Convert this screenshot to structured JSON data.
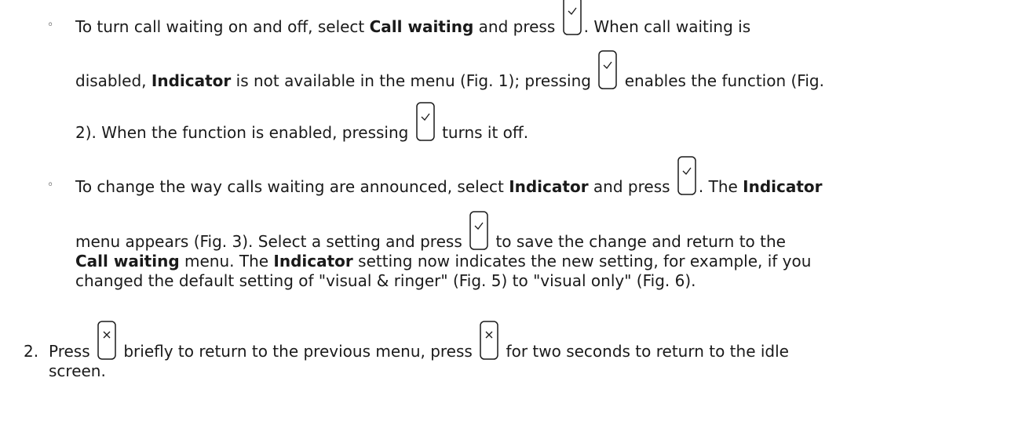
{
  "bullets": {
    "b1": {
      "marker": "◦",
      "l1": {
        "t1": "To turn call waiting on and off, select ",
        "t2": "Call waiting",
        "t3": " and press ",
        "t4": ".  When call waiting is"
      },
      "l2": {
        "t1": "disabled, ",
        "t2": "Indicator",
        "t3": " is not available in the menu (Fig. 1); pressing ",
        "t4": " enables the function (Fig."
      },
      "l3": {
        "t1": "2).  When the function is enabled, pressing ",
        "t2": " turns it off."
      }
    },
    "b2": {
      "marker": "◦",
      "l1": {
        "t1": "To change the way calls waiting are announced, select ",
        "t2": "Indicator",
        "t3": " and press ",
        "t4": ".  The ",
        "t5": "Indicator"
      },
      "l2": {
        "t1": "menu appears (Fig. 3).  Select a setting and press ",
        "t2": " to save the change and return to the"
      },
      "l3": {
        "t1": "Call waiting",
        "t2": " menu.  The ",
        "t3": "Indicator",
        "t4": " setting now indicates the new setting, for example, if you"
      },
      "l4": {
        "t1": "changed the default setting of \"visual & ringer\" (Fig. 5) to \"visual only\" (Fig. 6)."
      }
    }
  },
  "step2": {
    "number": "2.",
    "l1": {
      "t1": "Press ",
      "t2": " briefly to return to the previous menu, press ",
      "t3": " for two seconds to return to the idle"
    },
    "l2": {
      "t1": "screen."
    }
  },
  "icons": {
    "ok_key": "checkmark-key-icon",
    "cancel_key": "x-key-icon"
  },
  "colors": {
    "text": "#1a1a1a",
    "icon_stroke": "#1a1a1a"
  }
}
